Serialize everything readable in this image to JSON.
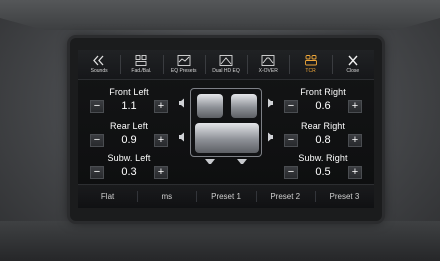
{
  "toolbar": {
    "items": [
      {
        "label": "Sounds",
        "icon": "chevron-left-icon"
      },
      {
        "label": "Fad./Bal.",
        "icon": "fader-balance-icon"
      },
      {
        "label": "EQ Presets",
        "icon": "eq-presets-icon"
      },
      {
        "label": "Dual HD EQ",
        "icon": "dual-hd-eq-icon"
      },
      {
        "label": "X-OVER",
        "icon": "crossover-icon"
      },
      {
        "label": "TCR",
        "icon": "tcr-icon",
        "active": true
      },
      {
        "label": "Close",
        "icon": "close-icon"
      }
    ]
  },
  "controls": {
    "front_left": {
      "label": "Front Left",
      "value": "1.1"
    },
    "front_right": {
      "label": "Front Right",
      "value": "0.6"
    },
    "rear_left": {
      "label": "Rear Left",
      "value": "0.9"
    },
    "rear_right": {
      "label": "Rear Right",
      "value": "0.8"
    },
    "subw_left": {
      "label": "Subw. Left",
      "value": "0.3"
    },
    "subw_right": {
      "label": "Subw. Right",
      "value": "0.5"
    },
    "minus": "−",
    "plus": "+"
  },
  "presets": [
    "Flat",
    "ms",
    "Preset 1",
    "Preset 2",
    "Preset 3"
  ],
  "colors": {
    "active": "#f1a83a",
    "text": "#ffffff"
  }
}
